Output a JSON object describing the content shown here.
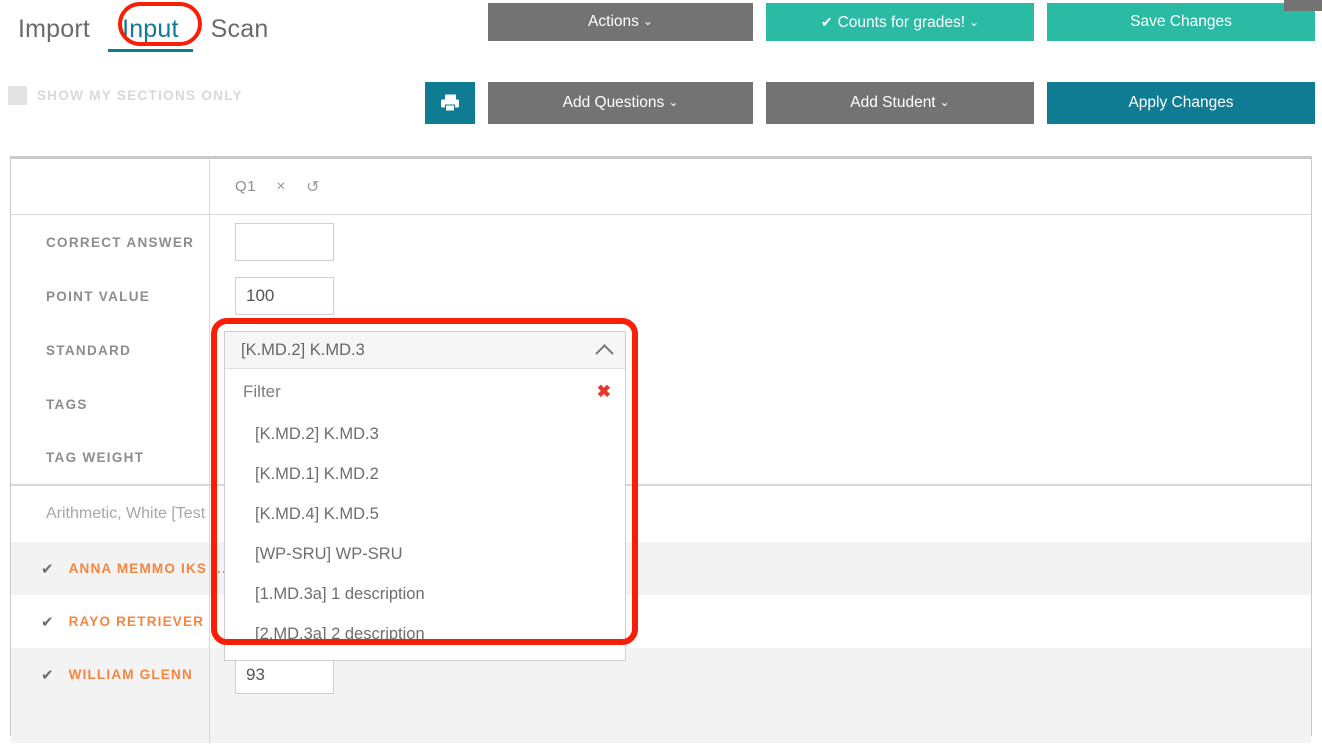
{
  "nav": {
    "tabs": [
      {
        "label": "Import",
        "active": false
      },
      {
        "label": "Input",
        "active": true
      },
      {
        "label": "Scan",
        "active": false
      }
    ]
  },
  "topbar": {
    "actions_label": "Actions",
    "actions_caret": "⌄",
    "counts_check": "✔",
    "counts_label": "Counts for grades!",
    "counts_caret": "⌄",
    "save_label": "Save Changes"
  },
  "toolbar": {
    "show_sections_label": "SHOW MY SECTIONS ONLY",
    "print_icon": "printer-icon",
    "add_questions_label": "Add Questions",
    "add_questions_caret": "⌄",
    "add_student_label": "Add Student",
    "add_student_caret": "⌄",
    "apply_label": "Apply Changes"
  },
  "grid": {
    "question_header": {
      "label": "Q1",
      "delete_icon": "×",
      "undo_icon": "↺"
    },
    "attributes": [
      {
        "label": "CORRECT ANSWER",
        "value": "",
        "placeholder": ""
      },
      {
        "label": "POINT VALUE",
        "value": "100",
        "placeholder": ""
      },
      {
        "label": "STANDARD",
        "value": "",
        "placeholder": ""
      },
      {
        "label": "TAGS",
        "value": "",
        "placeholder": ""
      },
      {
        "label": "TAG WEIGHT",
        "value": "",
        "placeholder": ""
      }
    ],
    "section": {
      "label": "Arithmetic, White [Test Section"
    },
    "students": [
      {
        "check": "✔",
        "name": "ANNA MEMMO IKS ...",
        "score": ""
      },
      {
        "check": "✔",
        "name": "RAYO RETRIEVER",
        "score": ""
      },
      {
        "check": "✔",
        "name": "WILLIAM GLENN",
        "score": "93"
      }
    ]
  },
  "dropdown": {
    "selected": "[K.MD.2] K.MD.3",
    "chevron": "chevron-up-icon",
    "filter_value": "",
    "filter_placeholder": "Filter",
    "clear_icon": "✖",
    "options": [
      "[K.MD.2] K.MD.3",
      "[K.MD.1] K.MD.2",
      "[K.MD.4] K.MD.5",
      "[WP-SRU] WP-SRU",
      "[1.MD.3a] 1 description",
      "[2.MD.3a] 2 description"
    ]
  },
  "colors": {
    "teal": "#2bbba5",
    "dark_teal": "#0f7c94",
    "gray_button": "#737373",
    "orange": "#f5853f",
    "highlight_red": "#f91e08"
  }
}
